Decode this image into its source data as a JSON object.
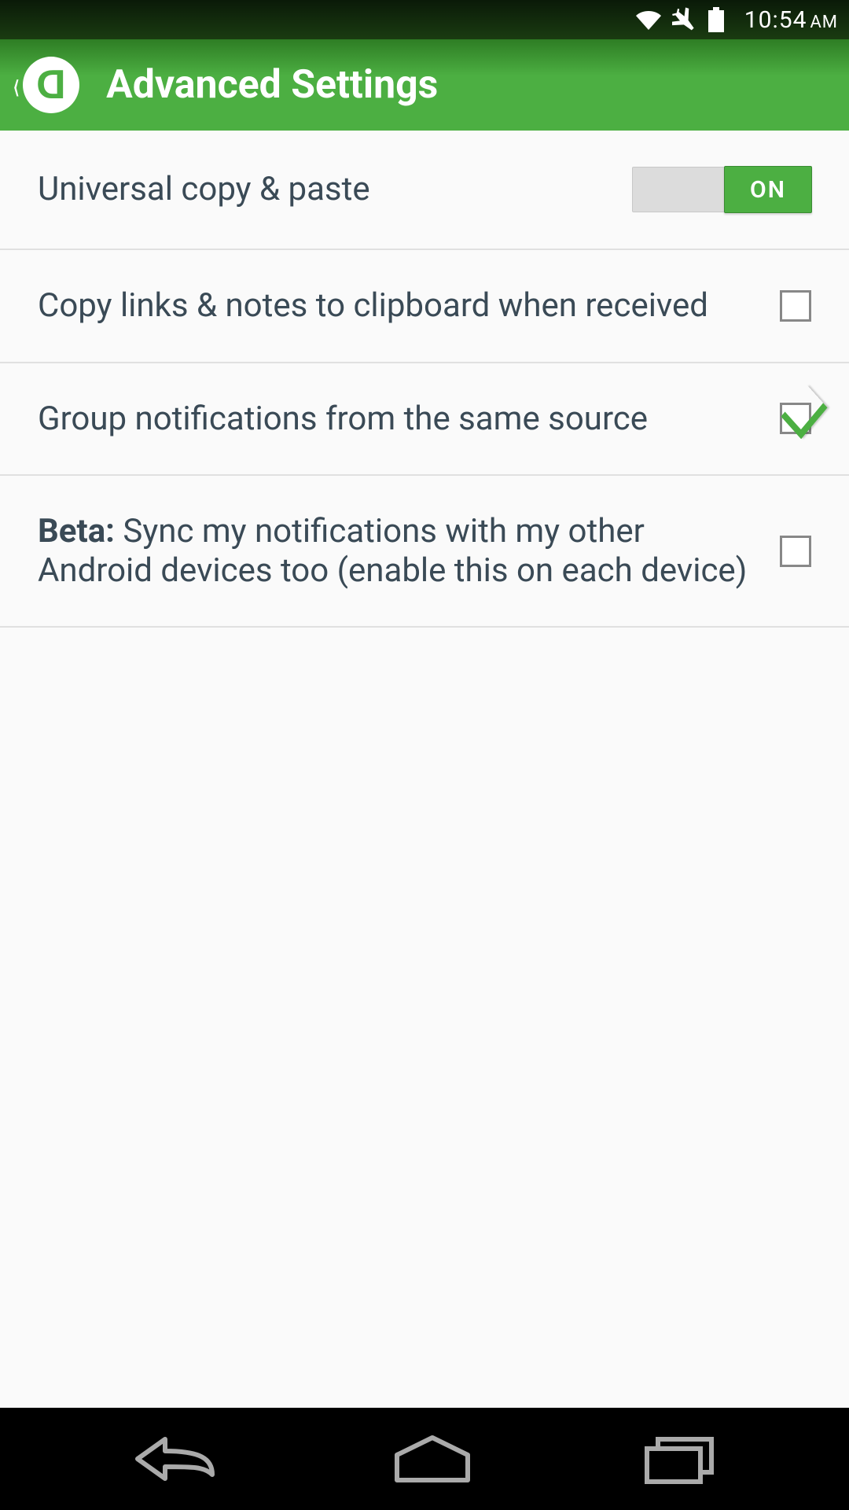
{
  "status": {
    "time": "10:54",
    "ampm": "AM"
  },
  "header": {
    "title": "Advanced Settings",
    "logo_letter": "D"
  },
  "settings": {
    "universal_copy": {
      "label": "Universal copy & paste",
      "toggle_label": "ON"
    },
    "copy_to_clipboard": {
      "label": "Copy links & notes to clipboard when received",
      "checked": false
    },
    "group_notifications": {
      "label": "Group notifications from the same source",
      "checked": true
    },
    "beta_sync": {
      "bold_prefix": "Beta:",
      "label_rest": " Sync my notifications with my other Android devices too (enable this on each device)",
      "checked": false
    }
  }
}
